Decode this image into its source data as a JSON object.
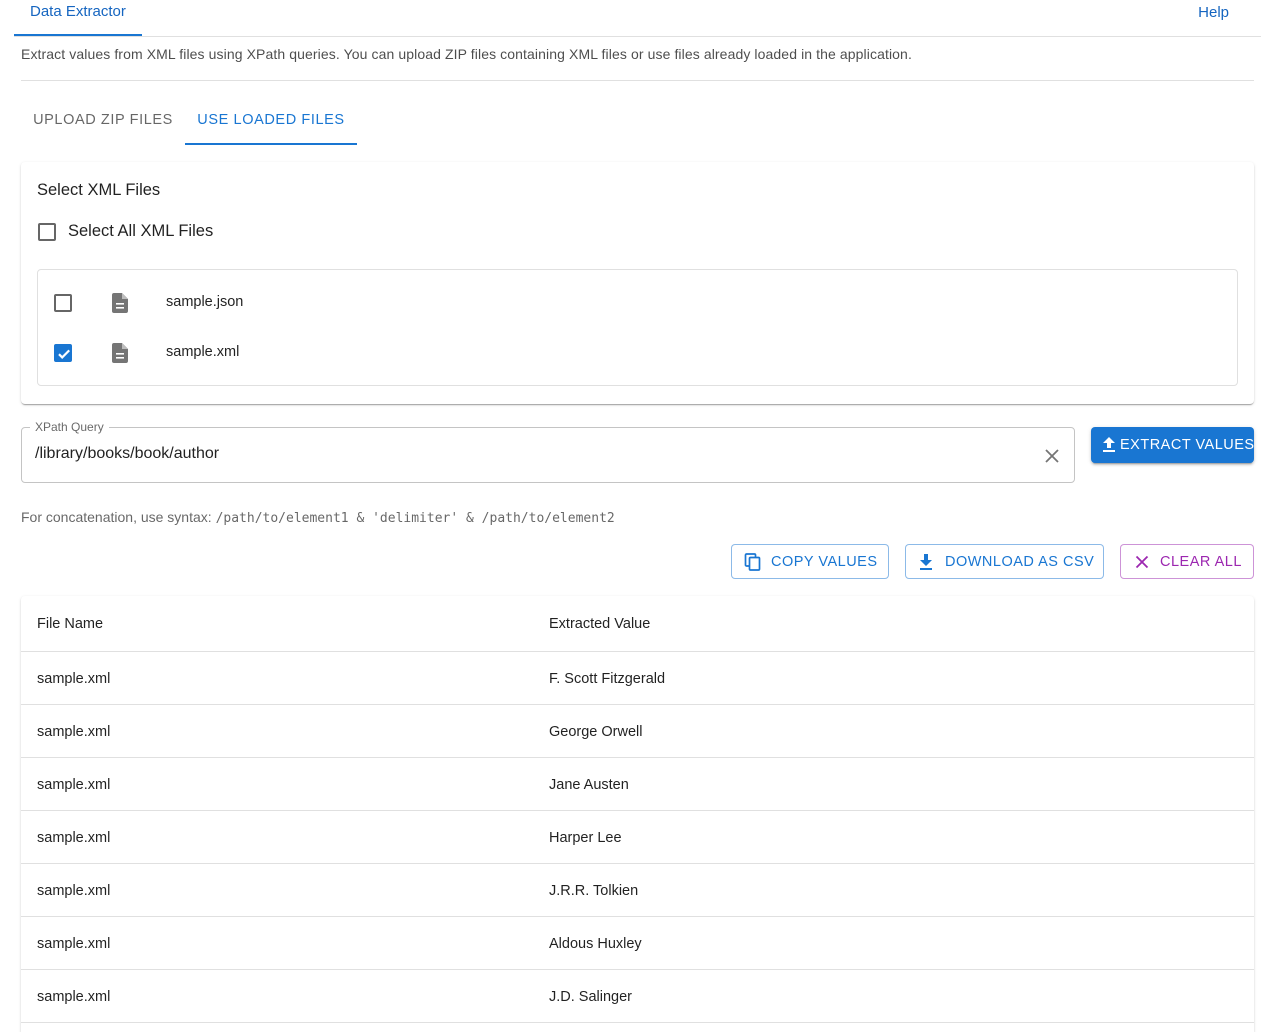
{
  "header": {
    "tab_label": "Data Extractor",
    "help_label": "Help"
  },
  "description": "Extract values from XML files using XPath queries. You can upload ZIP files containing XML files or use files already loaded in the application.",
  "mode_tabs": {
    "upload_label": "UPLOAD ZIP FILES",
    "loaded_label": "USE LOADED FILES",
    "active": "USE LOADED FILES"
  },
  "file_selector": {
    "title": "Select XML Files",
    "select_all_label": "Select All XML Files",
    "select_all_checked": false,
    "files": [
      {
        "name": "sample.json",
        "checked": false,
        "icon": "document-icon"
      },
      {
        "name": "sample.xml",
        "checked": true,
        "icon": "document-icon"
      }
    ]
  },
  "xpath": {
    "label": "XPath Query",
    "value": "/library/books/book/author"
  },
  "actions": {
    "extract_label": "EXTRACT VALUES",
    "copy_label": "COPY VALUES",
    "csv_label": "DOWNLOAD AS CSV",
    "clear_label": "CLEAR ALL"
  },
  "hint": {
    "prefix": "For concatenation, use syntax: ",
    "syntax": "/path/to/element1 & 'delimiter' & /path/to/element2"
  },
  "results": {
    "headers": [
      "File Name",
      "Extracted Value"
    ],
    "rows": [
      {
        "file": "sample.xml",
        "value": "F. Scott Fitzgerald"
      },
      {
        "file": "sample.xml",
        "value": "George Orwell"
      },
      {
        "file": "sample.xml",
        "value": "Jane Austen"
      },
      {
        "file": "sample.xml",
        "value": "Harper Lee"
      },
      {
        "file": "sample.xml",
        "value": "J.R.R. Tolkien"
      },
      {
        "file": "sample.xml",
        "value": "Aldous Huxley"
      },
      {
        "file": "sample.xml",
        "value": "J.D. Salinger"
      }
    ]
  },
  "colors": {
    "primary": "#1976d2",
    "secondary": "#9c27b0"
  }
}
